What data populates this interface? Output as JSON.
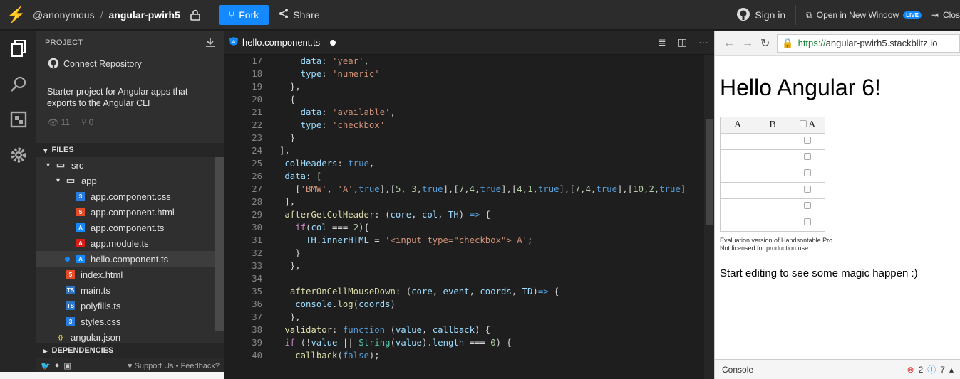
{
  "topbar": {
    "user": "@anonymous",
    "project": "angular-pwirh5",
    "fork_label": "Fork",
    "share_label": "Share",
    "signin_label": "Sign in",
    "open_new_window_label": "Open in New Window",
    "live_badge": "LIVE",
    "close_label": "Clos"
  },
  "sidebar": {
    "project_header": "PROJECT",
    "connect_repo": "Connect Repository",
    "description": "Starter project for Angular apps that exports to the Angular CLI",
    "views": "11",
    "forks": "0",
    "files_header": "FILES",
    "dependencies_header": "DEPENDENCIES",
    "support_label": "Support Us",
    "feedback_label": "Feedback?",
    "tree": [
      {
        "name": "src",
        "indent": 1,
        "kind": "folder"
      },
      {
        "name": "app",
        "indent": 2,
        "kind": "folder"
      },
      {
        "name": "app.component.css",
        "indent": 3,
        "kind": "css"
      },
      {
        "name": "app.component.html",
        "indent": 3,
        "kind": "html"
      },
      {
        "name": "app.component.ts",
        "indent": 3,
        "kind": "angular"
      },
      {
        "name": "app.module.ts",
        "indent": 3,
        "kind": "angular-red"
      },
      {
        "name": "hello.component.ts",
        "indent": 3,
        "kind": "angular",
        "selected": true
      },
      {
        "name": "index.html",
        "indent": 2,
        "kind": "html"
      },
      {
        "name": "main.ts",
        "indent": 2,
        "kind": "ts"
      },
      {
        "name": "polyfills.ts",
        "indent": 2,
        "kind": "ts"
      },
      {
        "name": "styles.css",
        "indent": 2,
        "kind": "css"
      },
      {
        "name": "angular.json",
        "indent": 1,
        "kind": "json"
      }
    ]
  },
  "editor": {
    "tab_label": "hello.component.ts",
    "current_line": 23,
    "lines": [
      {
        "n": "17",
        "html": "    <span class='v'>data</span><span class='p'>: </span><span class='s'>'year'</span><span class='p'>,</span>"
      },
      {
        "n": "18",
        "html": "    <span class='v'>type</span><span class='p'>: </span><span class='s'>'numeric'</span>"
      },
      {
        "n": "19",
        "html": "  <span class='p'>},</span>"
      },
      {
        "n": "20",
        "html": "  <span class='p'>{</span>"
      },
      {
        "n": "21",
        "html": "    <span class='v'>data</span><span class='p'>: </span><span class='s'>'available'</span><span class='p'>,</span>"
      },
      {
        "n": "22",
        "html": "    <span class='v'>type</span><span class='p'>: </span><span class='s'>'checkbox'</span>"
      },
      {
        "n": "23",
        "html": "  <span class='p'>}</span>"
      },
      {
        "n": "24",
        "html": "<span class='p'>],</span>"
      },
      {
        "n": "25",
        "html": " <span class='v'>colHeaders</span><span class='p'>: </span><span class='k'>true</span><span class='p'>,</span>"
      },
      {
        "n": "26",
        "html": " <span class='v'>data</span><span class='p'>: [</span>"
      },
      {
        "n": "27",
        "html": "   <span class='p'>[</span><span class='s'>'BMW'</span><span class='p'>, </span><span class='s'>'A'</span><span class='p'>,</span><span class='k'>true</span><span class='p'>],[</span><span class='n'>5</span><span class='p'>, </span><span class='n'>3</span><span class='p'>,</span><span class='k'>true</span><span class='p'>],[</span><span class='n'>7</span><span class='p'>,</span><span class='n'>4</span><span class='p'>,</span><span class='k'>true</span><span class='p'>],[</span><span class='n'>4</span><span class='p'>,</span><span class='n'>1</span><span class='p'>,</span><span class='k'>true</span><span class='p'>],[</span><span class='n'>7</span><span class='p'>,</span><span class='n'>4</span><span class='p'>,</span><span class='k'>true</span><span class='p'>],[</span><span class='n'>10</span><span class='p'>,</span><span class='n'>2</span><span class='p'>,</span><span class='k'>true</span><span class='p'>]</span>"
      },
      {
        "n": "28",
        "html": " <span class='p'>],</span>"
      },
      {
        "n": "29",
        "html": " <span class='f'>afterGetColHeader</span><span class='p'>: (</span><span class='v'>core</span><span class='p'>, </span><span class='v'>col</span><span class='p'>, </span><span class='v'>TH</span><span class='p'>) </span><span class='k'>=></span><span class='p'> {</span>"
      },
      {
        "n": "30",
        "html": "   <span class='kw'>if</span><span class='p'>(</span><span class='v'>col</span><span class='p'> === </span><span class='n'>2</span><span class='p'>){</span>"
      },
      {
        "n": "31",
        "html": "     <span class='v'>TH</span><span class='p'>.</span><span class='v'>innerHTML</span><span class='p'> = </span><span class='s'>'&lt;input type=\"checkbox\"&gt; A'</span><span class='p'>;</span>"
      },
      {
        "n": "32",
        "html": "   <span class='p'>}</span>"
      },
      {
        "n": "33",
        "html": "  <span class='p'>},</span>"
      },
      {
        "n": "34",
        "html": ""
      },
      {
        "n": "35",
        "html": "  <span class='f'>afterOnCellMouseDown</span><span class='p'>: (</span><span class='v'>core</span><span class='p'>, </span><span class='v'>event</span><span class='p'>, </span><span class='v'>coords</span><span class='p'>, </span><span class='v'>TD</span><span class='p'>)</span><span class='k'>=></span><span class='p'> {</span>"
      },
      {
        "n": "36",
        "html": "   <span class='v'>console</span><span class='p'>.</span><span class='f'>log</span><span class='p'>(</span><span class='v'>coords</span><span class='p'>)</span>"
      },
      {
        "n": "37",
        "html": "  <span class='p'>},</span>"
      },
      {
        "n": "38",
        "html": " <span class='f'>validator</span><span class='p'>: </span><span class='k'>function</span><span class='p'> (</span><span class='v'>value</span><span class='p'>, </span><span class='v'>callback</span><span class='p'>) {</span>"
      },
      {
        "n": "39",
        "html": " <span class='kw'>if</span><span class='p'> (!</span><span class='v'>value</span><span class='p'> || </span><span class='c'>String</span><span class='p'>(</span><span class='v'>value</span><span class='p'>).</span><span class='v'>length</span><span class='p'> === </span><span class='n'>0</span><span class='p'>) {</span>"
      },
      {
        "n": "40",
        "html": "   <span class='f'>callback</span><span class='p'>(</span><span class='k'>false</span><span class='p'>);</span>"
      }
    ]
  },
  "preview": {
    "url_scheme": "https://",
    "url_host": "angular-pwirh5.stackblitz.io",
    "heading": "Hello Angular 6!",
    "table_headers": [
      "A",
      "B",
      "A"
    ],
    "table_rows": 6,
    "eval_line1": "Evaluation version of Handsontable Pro.",
    "eval_line2": "Not licensed for production use.",
    "magic_text": "Start editing to see some magic happen :)",
    "console_label": "Console",
    "error_count": "2",
    "info_count": "7"
  },
  "colors": {
    "accent": "#1389fd",
    "error": "#e53935",
    "info": "#1e88e5"
  }
}
